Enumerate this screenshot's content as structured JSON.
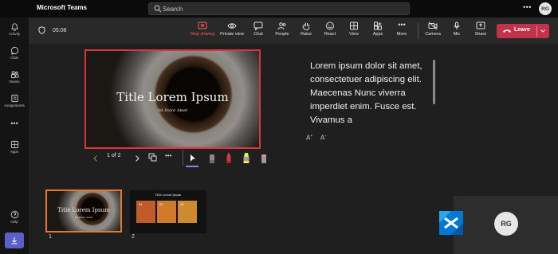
{
  "app": {
    "title": "Microsoft Teams"
  },
  "search": {
    "placeholder": "Search"
  },
  "user": {
    "initials": "RG"
  },
  "rail": {
    "items": [
      {
        "label": "Activity"
      },
      {
        "label": "Chat"
      },
      {
        "label": "Teams"
      },
      {
        "label": "Assignments"
      },
      {
        "label": "Apps"
      },
      {
        "label": "Help"
      }
    ]
  },
  "meeting": {
    "timer": "05:06",
    "tools": [
      {
        "label": "Stop sharing"
      },
      {
        "label": "Private view"
      },
      {
        "label": "Chat"
      },
      {
        "label": "People"
      },
      {
        "label": "Raise"
      },
      {
        "label": "React"
      },
      {
        "label": "View"
      },
      {
        "label": "Apps"
      },
      {
        "label": "More"
      },
      {
        "label": "Camera"
      },
      {
        "label": "Mic"
      },
      {
        "label": "Share"
      }
    ],
    "leave_label": "Leave"
  },
  "presentation": {
    "slide_title": "Title Lorem Ipsum",
    "slide_subtitle": "Sit Dolor Amet",
    "pager": "1 of 2",
    "notes": "Lorem ipsum dolor sit amet, consectetuer adipiscing elit. Maecenas Nunc viverra imperdiet enim. Fusce est. Vivamus a",
    "font_increase": "A",
    "font_decrease": "A",
    "thumbnails": [
      {
        "number": "1",
        "title": "Title Lorem Ipsum",
        "subtitle": "Sit Dolor Amet"
      },
      {
        "number": "2",
        "title": "Title Lorem Ipsum",
        "boxes": [
          "01",
          "02",
          "03"
        ]
      }
    ]
  },
  "colors": {
    "accent": "#5b5fc7",
    "leave": "#c4314b",
    "sharing": "#d9363e",
    "selected": "#e8762c"
  }
}
